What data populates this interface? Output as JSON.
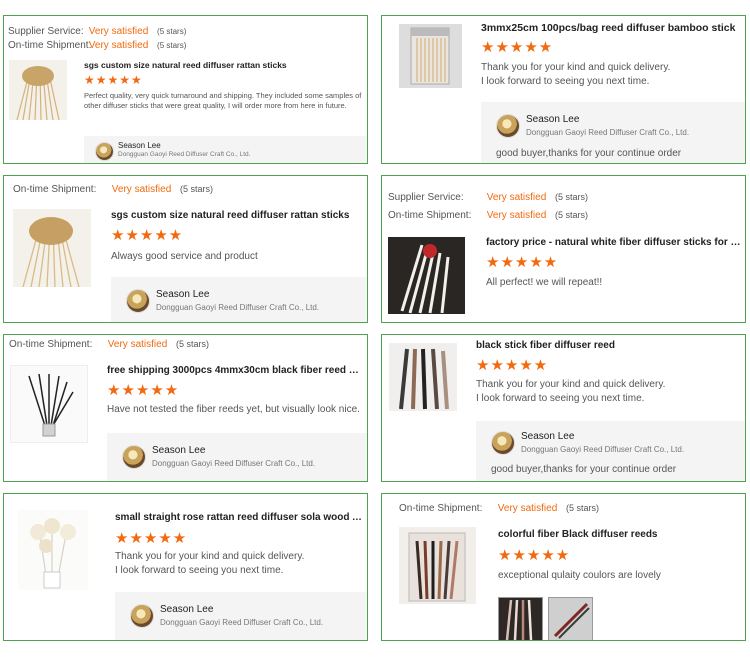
{
  "labels": {
    "supplier_service": "Supplier Service:",
    "ontime_shipment": "On-time Shipment:",
    "very_satisfied": "Very satisfied",
    "five_stars": "(5 stars)",
    "stars_glyphs": "★★★★★"
  },
  "seller": {
    "name": "Season Lee",
    "company": "Dongguan Gaoyi Reed Diffuser Craft Co., Ltd."
  },
  "reviews": [
    {
      "title": "sgs custom size natural reed diffuser rattan sticks",
      "comment": "Perfect quality, very quick turnaround and shipping. They included some samples of other diffuser sticks that were great quality, I will order more from here in future.",
      "reply": ""
    },
    {
      "title": "3mmx25cm 100pcs/bag reed diffuser bamboo stick",
      "comment_line1": "Thank you for your kind and quick delivery.",
      "comment_line2": "I look forward to seeing you next time.",
      "reply": "good buyer,thanks for your  continue order"
    },
    {
      "title": "sgs custom size natural reed diffuser rattan sticks",
      "comment": "Always good service and product",
      "reply": ""
    },
    {
      "title": "factory price - natural white fiber diffuser sticks for ho...",
      "comment": "All perfect! we will repeat!!",
      "reply": ""
    },
    {
      "title": "free shipping 3000pcs 4mmx30cm black fiber reed di...",
      "comment": "Have not tested the fiber reeds yet, but visually look nice.",
      "reply": ""
    },
    {
      "title": "black stick fiber diffuser reed",
      "comment_line1": "Thank you for your kind and quick delivery.",
      "comment_line2": "I look forward to seeing you next time.",
      "reply": "good buyer,thanks for your  continue order"
    },
    {
      "title": "small straight rose rattan reed diffuser sola wood Air ...",
      "comment_line1": "Thank you for your kind and quick delivery.",
      "comment_line2": "I look forward to seeing you next time.",
      "reply": ""
    },
    {
      "title": "colorful fiber Black diffuser reeds",
      "comment": "exceptional qulaity coulors are lovely",
      "reply": ""
    }
  ],
  "colors": {
    "accent": "#f06a0f",
    "border": "#4fa34f",
    "star": "#f26a10"
  }
}
